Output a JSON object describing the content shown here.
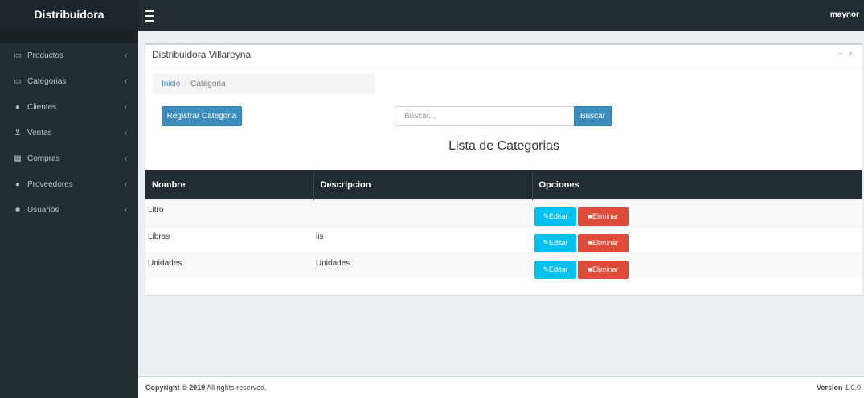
{
  "header": {
    "brand": "Distribuidora",
    "user": "maynor"
  },
  "sidebar": {
    "items": [
      {
        "label": "Productos",
        "icon": "laptop-icon"
      },
      {
        "label": "Categorias",
        "icon": "laptop-icon"
      },
      {
        "label": "Clientes",
        "icon": "user-icon"
      },
      {
        "label": "Ventas",
        "icon": "cart-icon"
      },
      {
        "label": "Compras",
        "icon": "grid-icon"
      },
      {
        "label": "Proveedores",
        "icon": "user-icon"
      },
      {
        "label": "Usuarios",
        "icon": "folder-icon"
      }
    ]
  },
  "box": {
    "title": "Distribuidora Villareyna"
  },
  "breadcrumb": {
    "home": "Inicio",
    "current": "Categoria"
  },
  "actions": {
    "register_label": "Registrar Categoria",
    "search_placeholder": "Buscar...",
    "search_button": "Buscar"
  },
  "list": {
    "title": "Lista de Categorias",
    "columns": [
      "Nombre",
      "Descripcion",
      "Opciones"
    ],
    "rows": [
      {
        "nombre": "Litro",
        "descripcion": ""
      },
      {
        "nombre": "Libras",
        "descripcion": "lis"
      },
      {
        "nombre": "Unidades",
        "descripcion": "Unidades"
      }
    ],
    "edit_label": "Editar",
    "delete_label": "Eliminar"
  },
  "footer": {
    "copyright_bold": "Copyright © 2019",
    "copyright_rest": " All rights reserved.",
    "version_label": "Version",
    "version_value": " 1.0.0"
  },
  "colors": {
    "sidebar": "#222d32",
    "primary": "#3c8dbc",
    "info": "#00c0ef",
    "danger": "#dd4b39"
  }
}
